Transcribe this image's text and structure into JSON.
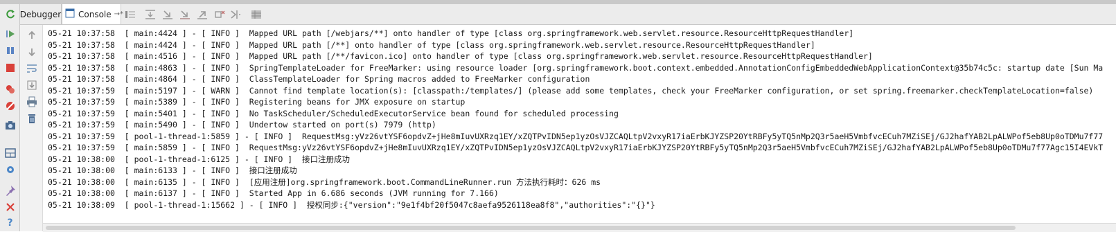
{
  "tabs": {
    "debugger": "Debugger",
    "console": "Console",
    "pin_marker": "→*"
  },
  "log_lines": [
    "05-21 10:37:58  [ main:4424 ] - [ INFO ]  Mapped URL path [/webjars/**] onto handler of type [class org.springframework.web.servlet.resource.ResourceHttpRequestHandler]",
    "05-21 10:37:58  [ main:4424 ] - [ INFO ]  Mapped URL path [/**] onto handler of type [class org.springframework.web.servlet.resource.ResourceHttpRequestHandler]",
    "05-21 10:37:58  [ main:4516 ] - [ INFO ]  Mapped URL path [/**/favicon.ico] onto handler of type [class org.springframework.web.servlet.resource.ResourceHttpRequestHandler]",
    "05-21 10:37:58  [ main:4863 ] - [ INFO ]  SpringTemplateLoader for FreeMarker: using resource loader [org.springframework.boot.context.embedded.AnnotationConfigEmbeddedWebApplicationContext@35b74c5c: startup date [Sun Ma",
    "05-21 10:37:58  [ main:4864 ] - [ INFO ]  ClassTemplateLoader for Spring macros added to FreeMarker configuration",
    "05-21 10:37:59  [ main:5197 ] - [ WARN ]  Cannot find template location(s): [classpath:/templates/] (please add some templates, check your FreeMarker configuration, or set spring.freemarker.checkTemplateLocation=false)",
    "05-21 10:37:59  [ main:5389 ] - [ INFO ]  Registering beans for JMX exposure on startup",
    "05-21 10:37:59  [ main:5401 ] - [ INFO ]  No TaskScheduler/ScheduledExecutorService bean found for scheduled processing",
    "05-21 10:37:59  [ main:5490 ] - [ INFO ]  Undertow started on port(s) 7979 (http)",
    "05-21 10:37:59  [ pool-1-thread-1:5859 ] - [ INFO ]  RequestMsg:yVz26vtYSF6opdvZ+jHe8mIuvUXRzq1EY/xZQTPvIDN5ep1yzOsVJZCAQLtpV2vxyR17iaErbKJYZSP20YtRBFy5yTQ5nMp2Q3r5aeH5VmbfvcECuh7MZiSEj/GJ2hafYAB2LpALWPof5eb8Up0oTDMu7f77",
    "05-21 10:37:59  [ main:5859 ] - [ INFO ]  RequestMsg:yVz26vtYSF6opdvZ+jHe8mIuvUXRzq1EY/xZQTPvIDN5ep1yzOsVJZCAQLtpV2vxyR17iaErbKJYZSP20YtRBFy5yTQ5nMp2Q3r5aeH5VmbfvcECuh7MZiSEj/GJ2hafYAB2LpALWPof5eb8Up0oTDMu7f77Agc15I4EVkT",
    "05-21 10:38:00  [ pool-1-thread-1:6125 ] - [ INFO ]  接口注册成功",
    "05-21 10:38:00  [ main:6133 ] - [ INFO ]  接口注册成功",
    "05-21 10:38:00  [ main:6135 ] - [ INFO ]  [应用注册]org.springframework.boot.CommandLineRunner.run 方法执行耗时：626 ms",
    "05-21 10:38:00  [ main:6137 ] - [ INFO ]  Started App in 6.686 seconds (JVM running for 7.166)",
    "05-21 10:38:09  [ pool-1-thread-1:15662 ] - [ INFO ]  授权同步:{\"version\":\"9e1f4bf20f5047c8aefa9526118ea8f8\",\"authorities\":\"{}\"}"
  ],
  "toolbar_icons": [
    "step-list-icon",
    "step-over-icon",
    "step-into-icon",
    "force-step-into-icon",
    "step-out-icon",
    "drop-frame-icon",
    "run-to-cursor-icon",
    "evaluate-icon"
  ],
  "side_icons": [
    "rerun-icon",
    "resume-icon",
    "pause-icon",
    "stop-icon",
    "view-breakpoints-icon",
    "mute-breakpoints-icon",
    "camera-icon",
    "layout-icon",
    "settings-icon",
    "pin-icon",
    "close-icon",
    "help-icon"
  ],
  "gutter_icons": [
    "up-arrow-icon",
    "down-arrow-icon",
    "soft-wrap-icon",
    "scroll-to-end-icon",
    "print-icon",
    "clear-all-icon"
  ]
}
